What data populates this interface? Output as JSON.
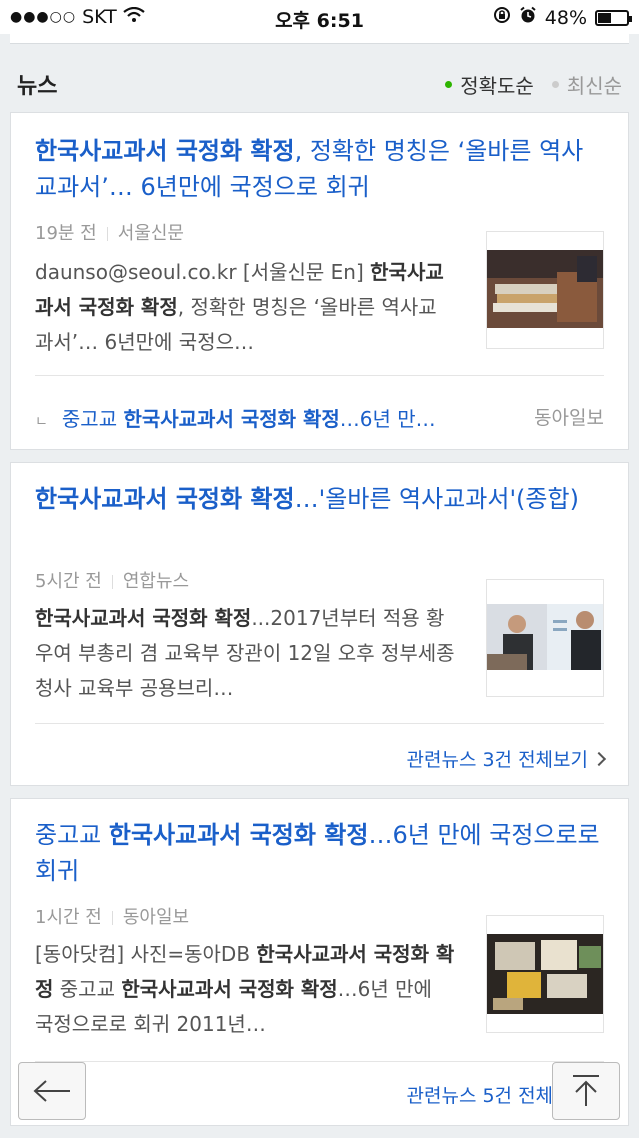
{
  "status_bar": {
    "signal": "●●●○○",
    "carrier": "SKT",
    "time": "오후 6:51",
    "battery": "48%",
    "battery_level": 0.48
  },
  "section": {
    "title": "뉴스",
    "sort_options": [
      {
        "label": "정확도순",
        "active": true,
        "dot_color": "#2db400"
      },
      {
        "label": "최신순",
        "active": false,
        "dot_color": "#cccccc"
      }
    ]
  },
  "articles": [
    {
      "headline_bold": "한국사교과서 국정화 확정",
      "headline_rest": ", 정확한 명칭은 ‘올바른 역사교과서’… 6년만에 국정으로 회귀",
      "time": "19분 전",
      "source": "서울신문",
      "snippet_prefix": "daunso@seoul.co.kr [서울신문 En] ",
      "snippet_bold": "한국사교과서 국정화 확정",
      "snippet_rest": ", 정확한 명칭은 ‘올바른 역사교과서’… 6년만에 국정으…",
      "sub": {
        "corner": "ㄴ",
        "prefix": "중고교 ",
        "bold": "한국사교과서 국정화 확정",
        "rest": "…6년 만…",
        "source": "동아일보"
      }
    },
    {
      "headline_bold": "한국사교과서 국정화 확정",
      "headline_rest": "…'올바른 역사교과서'(종합)",
      "time": "5시간 전",
      "source": "연합뉴스",
      "snippet_prefix": "",
      "snippet_bold": "한국사교과서 국정화 확정",
      "snippet_rest": "...2017년부터 적용 황우여 부총리 겸 교육부 장관이 12일 오후 정부세종청사 교육부 공용브리…",
      "related": "관련뉴스 3건 전체보기"
    },
    {
      "headline_prefix": "중고교 ",
      "headline_bold": "한국사교과서 국정화 확정",
      "headline_rest": "…6년 만에 국정으로로 회귀",
      "time": "1시간 전",
      "source": "동아일보",
      "snippet_prefix": "[동아닷컴] 사진=동아DB ",
      "snippet_bold": "한국사교과서 국정화 확정",
      "snippet_mid": " 중고교 ",
      "snippet_bold2": "한국사교과서 국정화 확정",
      "snippet_rest": "…6년 만에 국정으로로 회귀 2011년…",
      "related": "관련뉴스 5건 전체보기"
    }
  ],
  "floating": {
    "back_icon": "arrow-left-icon",
    "top_icon": "arrow-up-to-top-icon"
  }
}
